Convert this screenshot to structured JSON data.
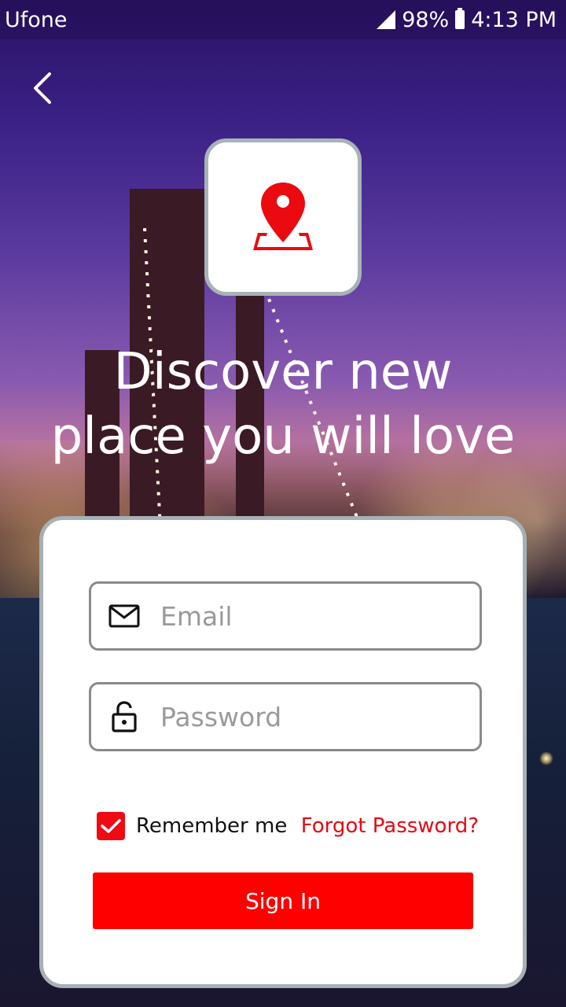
{
  "status_bar": {
    "carrier": "Ufone",
    "battery_percent": "98%",
    "time": "4:13 PM"
  },
  "header": {
    "back_icon": "chevron-left-icon",
    "logo_icon": "map-pin-icon"
  },
  "headline": {
    "line1": "Discover new",
    "line2": "place you will love"
  },
  "form": {
    "email": {
      "icon": "mail-icon",
      "placeholder": "Email",
      "value": ""
    },
    "password": {
      "icon": "lock-icon",
      "placeholder": "Password",
      "value": ""
    },
    "remember_me": {
      "label": "Remember me",
      "checked": true
    },
    "forgot_password_label": "Forgot Password?",
    "sign_in_label": "Sign In"
  },
  "colors": {
    "accent": "#ff0000",
    "link": "#e50914",
    "card_border": "#a7b0b4",
    "field_border": "#8a8a8a"
  }
}
